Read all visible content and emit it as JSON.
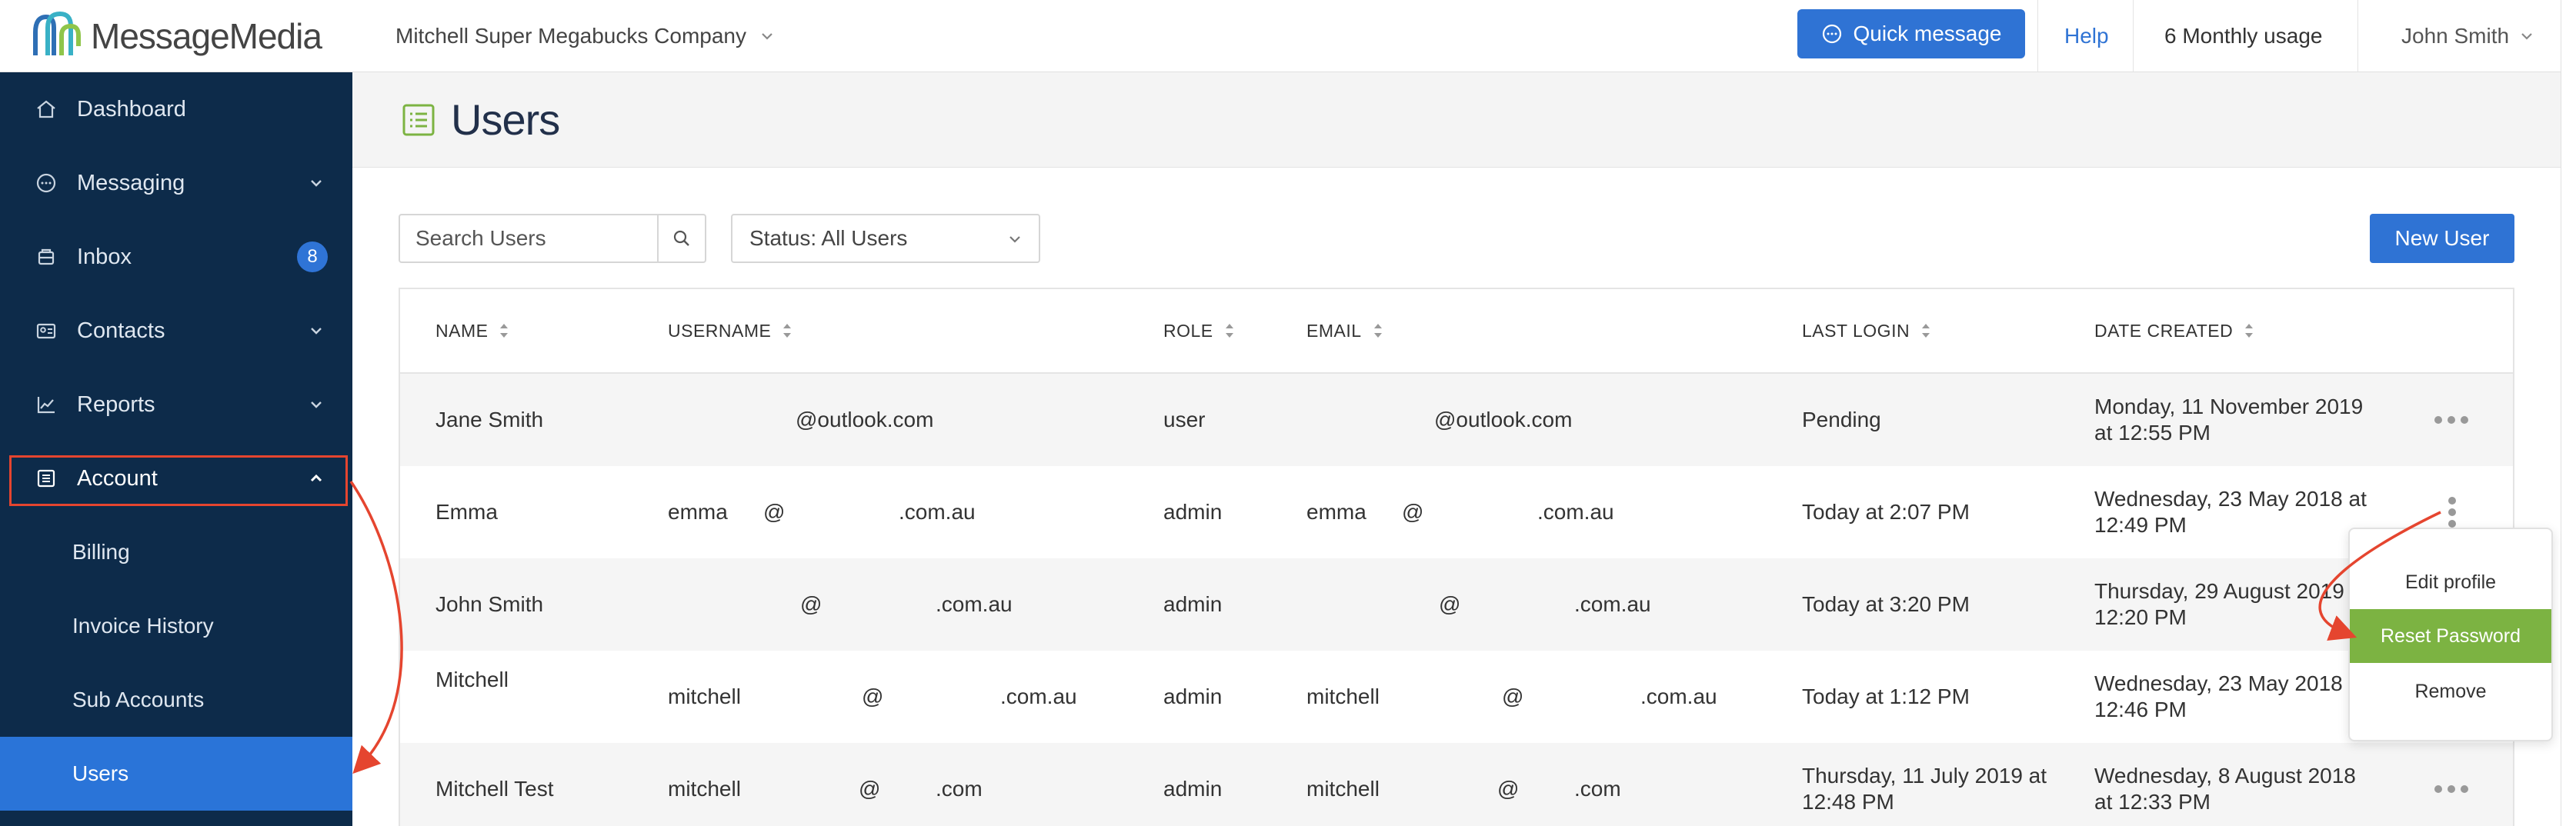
{
  "brand": {
    "name": "MessageMedia"
  },
  "sidebar": {
    "items": [
      {
        "label": "Dashboard",
        "icon": "home-icon"
      },
      {
        "label": "Messaging",
        "icon": "chat-bubble-icon",
        "expandable": true
      },
      {
        "label": "Inbox",
        "icon": "inbox-icon",
        "badge": "8"
      },
      {
        "label": "Contacts",
        "icon": "contacts-icon",
        "expandable": true
      },
      {
        "label": "Reports",
        "icon": "chart-icon",
        "expandable": true
      },
      {
        "label": "Account",
        "icon": "account-icon",
        "expanded": true
      }
    ],
    "subitems": [
      {
        "label": "Billing"
      },
      {
        "label": "Invoice History"
      },
      {
        "label": "Sub Accounts"
      },
      {
        "label": "Users",
        "active": true
      }
    ]
  },
  "header": {
    "company": "Mitchell Super Megabucks Company",
    "quick_message": "Quick message",
    "help": "Help",
    "usage": "6 Monthly usage",
    "user": "John Smith"
  },
  "page": {
    "title": "Users"
  },
  "toolbar": {
    "search_placeholder": "Search Users",
    "status_filter": "Status: All Users",
    "new_user": "New User"
  },
  "table": {
    "columns": [
      "NAME",
      "USERNAME",
      "ROLE",
      "EMAIL",
      "LAST LOGIN",
      "DATE CREATED"
    ],
    "rows": [
      {
        "name": "Jane Smith",
        "username": "@outlook.com",
        "role": "user",
        "email": "@outlook.com",
        "last_login": "Pending",
        "date_created": "Monday, 11 November 2019 at 12:55 PM"
      },
      {
        "name": "Emma",
        "username_a": "emma",
        "username_b": "@",
        "username_c": ".com.au",
        "role": "admin",
        "email_a": "emma",
        "email_b": "@",
        "email_c": ".com.au",
        "last_login": "Today at 2:07 PM",
        "date_created": "Wednesday, 23 May 2018 at 12:49 PM"
      },
      {
        "name": "John Smith",
        "username_b": "@",
        "username_c": ".com.au",
        "role": "admin",
        "email_b": "@",
        "email_c": ".com.au",
        "last_login": "Today at 3:20 PM",
        "date_created": "Thursday, 29 August 2019 at 12:20 PM"
      },
      {
        "name": "Mitchell",
        "username_a": "mitchell",
        "username_b": "@",
        "username_c": ".com.au",
        "role": "admin",
        "email_a": "mitchell",
        "email_b": "@",
        "email_c": ".com.au",
        "last_login": "Today at 1:12 PM",
        "date_created": "Wednesday, 23 May 2018 at 12:46 PM"
      },
      {
        "name": "Mitchell Test",
        "username_a": "mitchell",
        "username_b": "@",
        "username_c": ".com",
        "role": "admin",
        "email_a": "mitchell",
        "email_b": "@",
        "email_c": ".com",
        "last_login": "Thursday, 11 July 2019 at 12:48 PM",
        "date_created": "Wednesday, 8 August 2018 at 12:33 PM"
      }
    ]
  },
  "row_menu": {
    "items": [
      "Edit profile",
      "Reset Password",
      "Remove"
    ],
    "highlighted": "Reset Password"
  },
  "colors": {
    "sidebar_bg": "#0d2b4a",
    "accent_blue": "#2f73d4",
    "highlight_green": "#7cb342",
    "annotation_red": "#e5452f"
  }
}
